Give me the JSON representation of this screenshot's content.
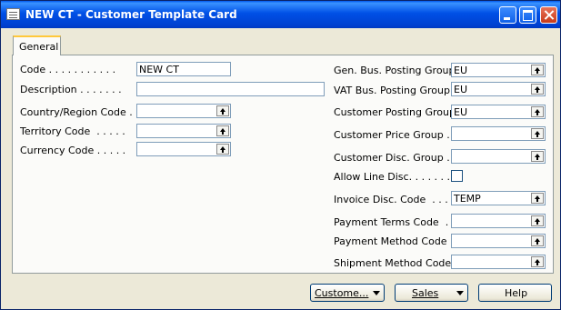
{
  "window": {
    "title": "NEW CT - Customer Template Card"
  },
  "tabs": [
    {
      "label": "General"
    }
  ],
  "left_fields": [
    {
      "label": "Code . . . . . . . . . . .",
      "value": "NEW CT",
      "lookup": false
    },
    {
      "label": "Description . . . . . . .",
      "value": "",
      "lookup": false
    },
    {
      "label": "Country/Region Code . .",
      "value": "",
      "lookup": true
    },
    {
      "label": "Territory Code  . . . . .",
      "value": "",
      "lookup": true
    },
    {
      "label": "Currency Code . . . . .",
      "value": "",
      "lookup": true
    }
  ],
  "right_fields": [
    {
      "label": "Gen. Bus. Posting Group .",
      "value": "EU",
      "lookup": true
    },
    {
      "label": "VAT Bus. Posting Group .",
      "value": "EU",
      "lookup": true
    },
    {
      "label": "Customer Posting Group .",
      "value": "EU",
      "lookup": true
    },
    {
      "label": "Customer Price Group . .",
      "value": "",
      "lookup": true
    },
    {
      "label": "Customer Disc. Group . .",
      "value": "",
      "lookup": true
    },
    {
      "label": "Allow Line Disc. . . . . . .",
      "checked": false
    },
    {
      "label": "Invoice Disc. Code  . . .",
      "value": "TEMP",
      "lookup": true
    },
    {
      "label": "Payment Terms Code  . .",
      "value": "",
      "lookup": true
    },
    {
      "label": "Payment Method Code  .",
      "value": "",
      "lookup": true
    },
    {
      "label": "Shipment Method Code  .",
      "value": "",
      "lookup": true
    }
  ],
  "buttons": {
    "customer": "Custome...",
    "sales": "Sales",
    "help": "Help"
  },
  "icons": {
    "window": "form-icon",
    "lookup": "lookup-arrow-icon"
  },
  "colors": {
    "titlebar": "#0050e6",
    "window_bg": "#ece9d8",
    "tab_accent": "#ffc83c",
    "close_button": "#c83a18"
  }
}
